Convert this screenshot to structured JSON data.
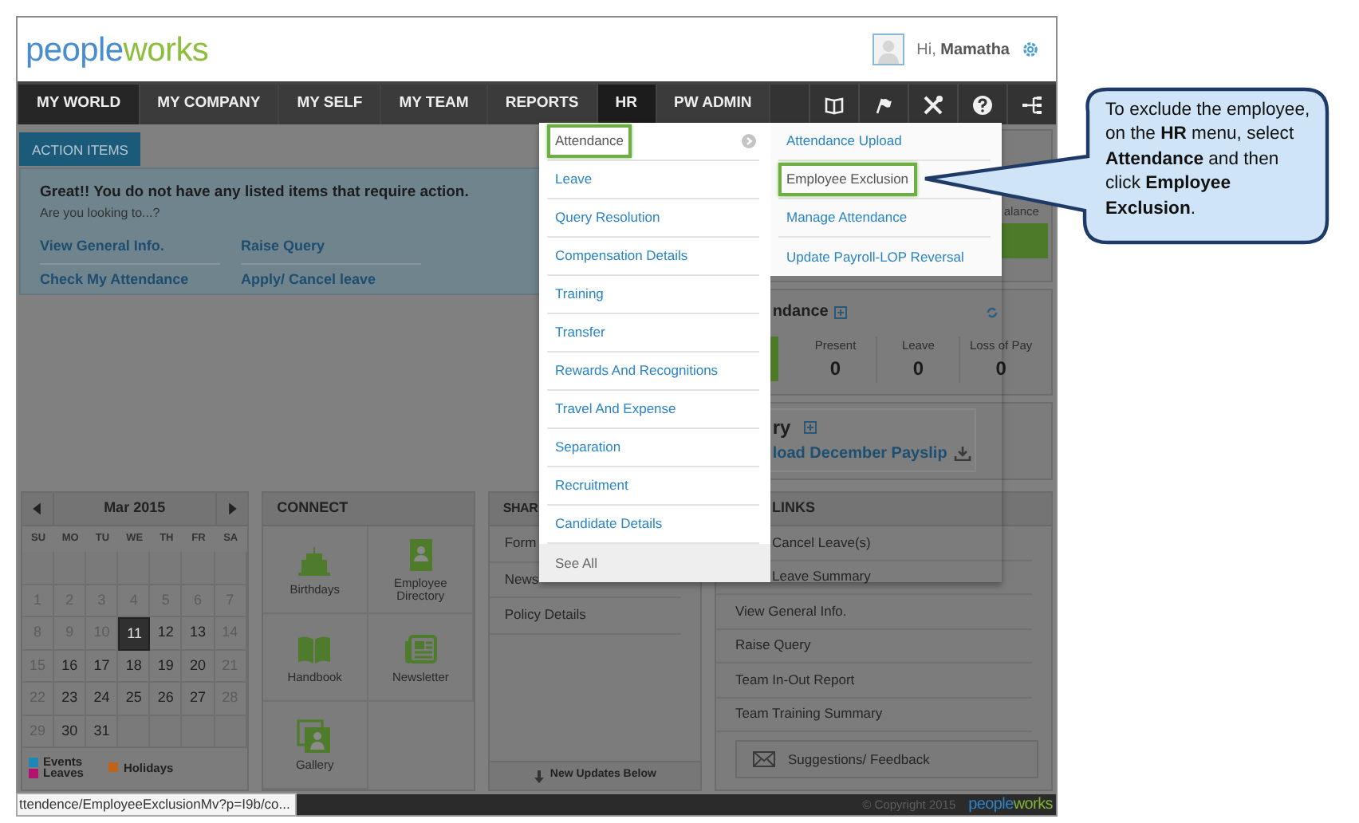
{
  "header": {
    "logo": [
      {
        "text": "people",
        "color": "#4a8dcf"
      },
      {
        "text": "works",
        "color": "#8cbf3f"
      }
    ],
    "greeting": "Hi, **Mamatha**"
  },
  "nav": {
    "tabs": [
      {
        "label": "MY WORLD",
        "selected": true,
        "expanded": false
      },
      {
        "label": "MY COMPANY",
        "selected": false,
        "expanded": false
      },
      {
        "label": "MY SELF",
        "selected": false,
        "expanded": false
      },
      {
        "label": "MY TEAM",
        "selected": false,
        "expanded": false
      },
      {
        "label": "REPORTS",
        "selected": false,
        "expanded": false
      },
      {
        "label": "HR",
        "selected": false,
        "expanded": true
      },
      {
        "label": "PW ADMIN",
        "selected": false,
        "expanded": false
      }
    ]
  },
  "hr_menu": {
    "items": [
      {
        "label": "Attendance",
        "selected": true
      },
      {
        "label": "Leave",
        "selected": false
      },
      {
        "label": "Query Resolution",
        "selected": false
      },
      {
        "label": "Compensation Details",
        "selected": false
      },
      {
        "label": "Training",
        "selected": false
      },
      {
        "label": "Transfer",
        "selected": false
      },
      {
        "label": "Rewards And Recognitions",
        "selected": false
      },
      {
        "label": "Travel And Expense",
        "selected": false
      },
      {
        "label": "Separation",
        "selected": false
      },
      {
        "label": "Recruitment",
        "selected": false
      },
      {
        "label": "Candidate Details",
        "selected": false
      }
    ],
    "see_all": "See All",
    "submenu": [
      {
        "label": "Attendance Upload",
        "selected": false
      },
      {
        "label": "Employee Exclusion",
        "selected": true
      },
      {
        "label": "Manage Attendance",
        "selected": false
      },
      {
        "label": "Update Payroll-LOP Reversal",
        "selected": false
      }
    ]
  },
  "action_items": {
    "tab": "ACTION ITEMS",
    "message": "Great!! You do not have any listed items that require action.",
    "prompt": "Are you looking to...?",
    "links": [
      "View General Info.",
      "Raise Query",
      "Check My Attendance",
      "Apply/ Cancel leave"
    ]
  },
  "leave_balance": {
    "label": "alance"
  },
  "attendance": {
    "title": "ndance",
    "stats": [
      {
        "label": "Present",
        "value": "0"
      },
      {
        "label": "Leave",
        "value": "0"
      },
      {
        "label": "Loss of Pay",
        "value": "0"
      }
    ]
  },
  "salary": {
    "title": "ry",
    "link": "load December Payslip"
  },
  "calendar": {
    "month": "Mar 2015",
    "weekdays": [
      "SU",
      "MO",
      "TU",
      "WE",
      "TH",
      "FR",
      "SA"
    ],
    "weeks": [
      [
        {
          "kind": "empty"
        },
        {
          "kind": "empty"
        },
        {
          "kind": "empty"
        },
        {
          "kind": "empty"
        },
        {
          "kind": "empty"
        },
        {
          "kind": "empty"
        },
        {
          "kind": "empty"
        }
      ],
      [
        {
          "kind": "day",
          "day": "1",
          "muted": true,
          "selected": false
        },
        {
          "kind": "day",
          "day": "2",
          "muted": true,
          "selected": false
        },
        {
          "kind": "day",
          "day": "3",
          "muted": true,
          "selected": false
        },
        {
          "kind": "day",
          "day": "4",
          "muted": true,
          "selected": false
        },
        {
          "kind": "day",
          "day": "5",
          "muted": true,
          "selected": false
        },
        {
          "kind": "day",
          "day": "6",
          "muted": true,
          "selected": false
        },
        {
          "kind": "day",
          "day": "7",
          "muted": true,
          "selected": false
        }
      ],
      [
        {
          "kind": "day",
          "day": "8",
          "muted": true,
          "selected": false
        },
        {
          "kind": "day",
          "day": "9",
          "muted": true,
          "selected": false
        },
        {
          "kind": "day",
          "day": "10",
          "muted": true,
          "selected": false
        },
        {
          "kind": "day",
          "day": "11",
          "muted": false,
          "selected": true
        },
        {
          "kind": "day",
          "day": "12",
          "muted": false,
          "selected": false
        },
        {
          "kind": "day",
          "day": "13",
          "muted": false,
          "selected": false
        },
        {
          "kind": "day",
          "day": "14",
          "muted": true,
          "selected": false
        }
      ],
      [
        {
          "kind": "day",
          "day": "15",
          "muted": true,
          "selected": false
        },
        {
          "kind": "day",
          "day": "16",
          "muted": false,
          "selected": false
        },
        {
          "kind": "day",
          "day": "17",
          "muted": false,
          "selected": false
        },
        {
          "kind": "day",
          "day": "18",
          "muted": false,
          "selected": false
        },
        {
          "kind": "day",
          "day": "19",
          "muted": false,
          "selected": false
        },
        {
          "kind": "day",
          "day": "20",
          "muted": false,
          "selected": false
        },
        {
          "kind": "day",
          "day": "21",
          "muted": true,
          "selected": false
        }
      ],
      [
        {
          "kind": "day",
          "day": "22",
          "muted": true,
          "selected": false
        },
        {
          "kind": "day",
          "day": "23",
          "muted": false,
          "selected": false
        },
        {
          "kind": "day",
          "day": "24",
          "muted": false,
          "selected": false
        },
        {
          "kind": "day",
          "day": "25",
          "muted": false,
          "selected": false
        },
        {
          "kind": "day",
          "day": "26",
          "muted": false,
          "selected": false
        },
        {
          "kind": "day",
          "day": "27",
          "muted": false,
          "selected": false
        },
        {
          "kind": "day",
          "day": "28",
          "muted": true,
          "selected": false
        }
      ],
      [
        {
          "kind": "day",
          "day": "29",
          "muted": true,
          "selected": false
        },
        {
          "kind": "day",
          "day": "30",
          "muted": false,
          "selected": false
        },
        {
          "kind": "day",
          "day": "31",
          "muted": false,
          "selected": false
        },
        {
          "kind": "empty"
        },
        {
          "kind": "empty"
        },
        {
          "kind": "empty"
        },
        {
          "kind": "empty"
        }
      ]
    ],
    "legend": [
      {
        "label": "Events",
        "color": "#1f86b8"
      },
      {
        "label": "Leaves",
        "color": "#b0146e"
      },
      {
        "label": "Holidays",
        "color": "#c0621a"
      }
    ]
  },
  "connect": {
    "title": "CONNECT",
    "tiles": [
      {
        "label": "Birthdays",
        "kind": "cake"
      },
      {
        "label": "Employee Directory",
        "kind": "directory"
      },
      {
        "label": "Handbook",
        "kind": "book"
      },
      {
        "label": "Newsletter",
        "kind": "newspaper"
      },
      {
        "label": "Gallery",
        "kind": "photo"
      }
    ]
  },
  "shared": {
    "title": "SHAR",
    "items": [
      "Form",
      "News",
      "Policy Details"
    ],
    "footer": "New Updates Below"
  },
  "quick_links": {
    "title": "LINKS",
    "items": [
      "Cancel Leave(s)",
      "Leave Summary",
      "View General Info.",
      "Raise Query",
      "Team In-Out Report",
      "Team Training Summary"
    ],
    "feedback": "Suggestions/ Feedback"
  },
  "footer": {
    "copyright": "© Copyright 2015",
    "logo": [
      {
        "text": "people",
        "color": "#2f84c8"
      },
      {
        "text": "works",
        "color": "#7fb536"
      }
    ]
  },
  "status_url": "ttendence/EmployeeExclusionMv?p=I9b/co...",
  "callout": "To exclude the employee, on the **HR** menu, select **Attendance** and then click **Employee Exclusion**."
}
